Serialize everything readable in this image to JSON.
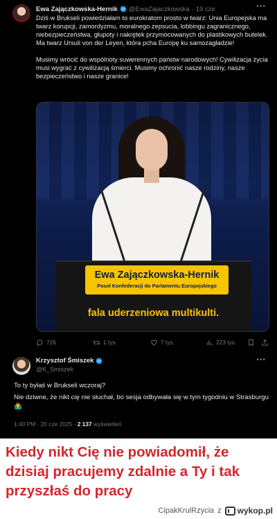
{
  "tweet1": {
    "author_name": "Ewa Zajączkowska-Hernik",
    "author_handle": "@EwaZajaczkowska",
    "time": "19 cze",
    "paragraphs": [
      "Dziś w Brukseli powiedziałam to eurokratom prosto w twarz: Unia Europejska ma twarz korupcji, zamordyzmu, moralnego zepsucia, lobbingu zagranicznego, niebezpieczeństwa, głupoty i nakrętek przymocowanych do plastikowych butelek. Ma twarz Ursuli von der Leyen, która pcha Europę ku samozagładzie!",
      "Musimy wrócić do wspólnoty suwerennych państw narodowych! Cywilizacja życia musi wygrać z cywilizacją śmierci. Musimy ochronić nasze rodziny, nasze bezpieczeństwo i nasze granice!"
    ],
    "video": {
      "lower_third_name": "Ewa Zajączkowska-Hernik",
      "lower_third_title": "Poseł Konfederacji do Parlamentu Europejskiego",
      "caption": "fala uderzeniowa multikulti."
    },
    "stats": {
      "replies": "726",
      "retweets": "1 tys.",
      "likes": "7 tys.",
      "views": "223 tys."
    }
  },
  "tweet2": {
    "author_name": "Krzysztof Śmiszek",
    "author_handle": "@K_Smiszek",
    "lines": [
      "To ty byłaś w Brukseli wczoraj?",
      "Nie dziwne, że nikt cię nie słuchał, bo sesja odbywała się w tym tygodniu w Strasburgu🤷‍♂️"
    ],
    "timestamp": "1:40 PM · 20 cze 2025 ·",
    "views_count": "2 137",
    "views_label": "wyświetleń"
  },
  "meme_caption": "Kiedy nikt Cię nie powiadomił, że dzisiaj pracujemy zdalnie a Ty i tak przyszłaś do pracy",
  "footer": {
    "user": "CipakKrulRzycia",
    "sep": "z",
    "site": "wykop.pl"
  },
  "colors": {
    "verified": "#1d9bf0",
    "caption_red": "#d4262b",
    "lower_third_yellow": "#f6c400"
  }
}
